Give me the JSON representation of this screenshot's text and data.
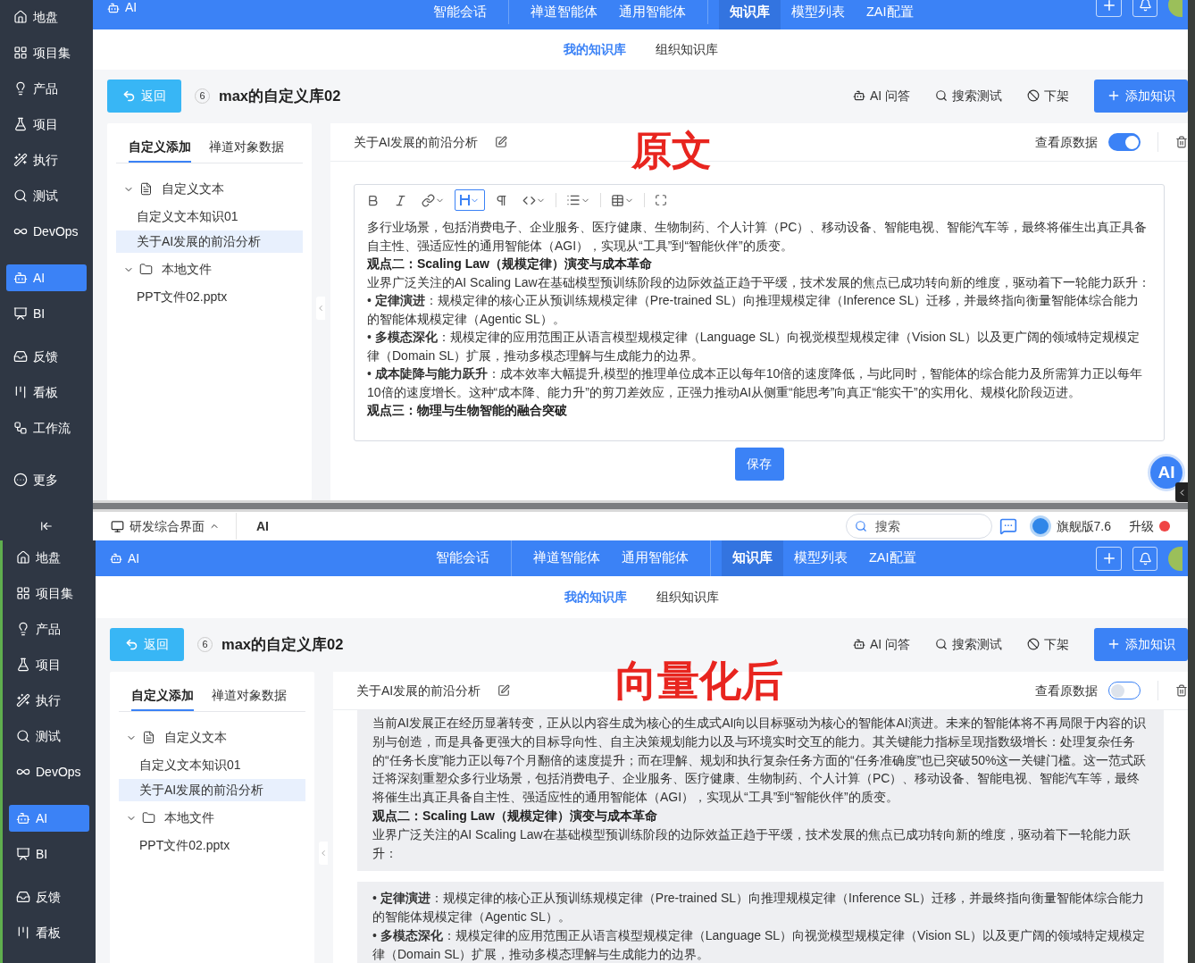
{
  "screens": [
    {
      "sidebar": {
        "items": [
          {
            "label": "地盘",
            "selected": false
          },
          {
            "label": "项目集",
            "selected": false
          },
          {
            "label": "产品",
            "selected": false
          },
          {
            "label": "项目",
            "selected": false
          },
          {
            "label": "执行",
            "selected": false
          },
          {
            "label": "测试",
            "selected": false
          },
          {
            "label": "DevOps",
            "selected": false
          },
          {
            "label": "AI",
            "selected": true
          },
          {
            "label": "BI",
            "selected": false
          },
          {
            "label": "反馈",
            "selected": false
          },
          {
            "label": "看板",
            "selected": false
          },
          {
            "label": "工作流",
            "selected": false
          },
          {
            "label": "更多",
            "selected": false
          }
        ]
      },
      "header": {
        "app": "AI",
        "nav": [
          [
            {
              "label": "智能会话",
              "selected": false
            }
          ],
          [
            {
              "label": "禅道智能体",
              "selected": false
            },
            {
              "label": "通用智能体",
              "selected": false
            }
          ],
          [
            {
              "label": "知识库",
              "selected": true
            },
            {
              "label": "模型列表",
              "selected": false
            },
            {
              "label": "ZAI配置",
              "selected": false
            }
          ]
        ]
      },
      "subnav": [
        {
          "label": "我的知识库",
          "selected": true
        },
        {
          "label": "组织知识库",
          "selected": false
        }
      ],
      "toolbar": {
        "back": "返回",
        "count": "6",
        "title": "max的自定义库02",
        "actions": [
          "AI 问答",
          "搜索测试",
          "下架"
        ],
        "add": "添加知识"
      },
      "left_panel": {
        "tabs": [
          {
            "label": "自定义添加",
            "selected": true
          },
          {
            "label": "禅道对象数据",
            "selected": false
          }
        ],
        "tree": [
          {
            "label": "自定义文本",
            "kind": "doc",
            "expanded": true,
            "children": [
              {
                "label": "自定义文本知识01",
                "selected": false
              },
              {
                "label": "关于AI发展的前沿分析",
                "selected": true
              }
            ]
          },
          {
            "label": "本地文件",
            "kind": "folder",
            "expanded": true,
            "children": [
              {
                "label": "PPT文件02.pptx",
                "selected": false
              }
            ]
          }
        ]
      },
      "doc": {
        "title": "关于AI发展的前沿分析",
        "annotation": "原文",
        "raw_toggle": {
          "label": "查看原数据",
          "on": true
        },
        "content": {
          "kind": "editor",
          "save": "保存",
          "blocks": [
            {
              "kind": "text",
              "text": "多行业场景，包括消费电子、企业服务、医疗健康、生物制药、个人计算（PC）、移动设备、智能电视、智能汽车等，最终将催生出真正具备自主性、强适应性的通用智能体（AGI），实现从“工具”到“智能伙伴”的质变。"
            },
            {
              "kind": "heading",
              "text": "观点二：Scaling Law（规模定律）演变与成本革命"
            },
            {
              "kind": "text",
              "text": "业界广泛关注的AI Scaling Law在基础模型预训练阶段的边际效益正趋于平缓，技术发展的焦点已成功转向新的维度，驱动着下一轮能力跃升："
            },
            {
              "kind": "text",
              "text": "• **定律演进**：规模定律的核心正从预训练规模定律（Pre-trained SL）向推理规模定律（Inference SL）迁移，并最终指向衡量智能体综合能力的智能体规模定律（Agentic SL）。"
            },
            {
              "kind": "text",
              "text": "• **多模态深化**：规模定律的应用范围正从语言模型规模定律（Language SL）向视觉模型规模定律（Vision SL）以及更广阔的领域特定规模定律（Domain SL）扩展，推动多模态理解与生成能力的边界。"
            },
            {
              "kind": "text",
              "text": "• **成本陡降与能力跃升**：成本效率大幅提升,模型的推理单位成本正以每年10倍的速度降低，与此同时，智能体的综合能力及所需算力正以每年10倍的速度增长。这种“成本降、能力升”的剪刀差效应，正强力推动AI从侧重“能思考”向真正“能实干”的实用化、规模化阶段迈进。"
            },
            {
              "kind": "heading",
              "text": "观点三：物理与生物智能的融合突破"
            }
          ]
        },
        "ai_button": "AI"
      }
    },
    {
      "sidebar": {
        "items": [
          {
            "label": "地盘",
            "selected": false
          },
          {
            "label": "项目集",
            "selected": false
          },
          {
            "label": "产品",
            "selected": false
          },
          {
            "label": "项目",
            "selected": false
          },
          {
            "label": "执行",
            "selected": false
          },
          {
            "label": "测试",
            "selected": false
          },
          {
            "label": "DevOps",
            "selected": false
          },
          {
            "label": "AI",
            "selected": true
          },
          {
            "label": "BI",
            "selected": false
          },
          {
            "label": "反馈",
            "selected": false
          },
          {
            "label": "看板",
            "selected": false
          }
        ]
      },
      "header": {
        "app": "AI",
        "nav": [
          [
            {
              "label": "智能会话",
              "selected": false
            }
          ],
          [
            {
              "label": "禅道智能体",
              "selected": false
            },
            {
              "label": "通用智能体",
              "selected": false
            }
          ],
          [
            {
              "label": "知识库",
              "selected": true
            },
            {
              "label": "模型列表",
              "selected": false
            },
            {
              "label": "ZAI配置",
              "selected": false
            }
          ]
        ]
      },
      "subnav": [
        {
          "label": "我的知识库",
          "selected": true
        },
        {
          "label": "组织知识库",
          "selected": false
        }
      ],
      "toolbar": {
        "back": "返回",
        "count": "6",
        "title": "max的自定义库02",
        "actions": [
          "AI 问答",
          "搜索测试",
          "下架"
        ],
        "add": "添加知识"
      },
      "left_panel": {
        "tabs": [
          {
            "label": "自定义添加",
            "selected": true
          },
          {
            "label": "禅道对象数据",
            "selected": false
          }
        ],
        "tree": [
          {
            "label": "自定义文本",
            "kind": "doc",
            "expanded": true,
            "children": [
              {
                "label": "自定义文本知识01",
                "selected": false
              },
              {
                "label": "关于AI发展的前沿分析",
                "selected": true
              }
            ]
          },
          {
            "label": "本地文件",
            "kind": "folder",
            "expanded": true,
            "children": [
              {
                "label": "PPT文件02.pptx",
                "selected": false
              }
            ]
          }
        ]
      },
      "doc": {
        "title": "关于AI发展的前沿分析",
        "annotation": "向量化后",
        "raw_toggle": {
          "label": "查看原数据",
          "on": false
        },
        "content": {
          "kind": "chunks",
          "chunks": [
            [
              {
                "kind": "text",
                "text": "当前AI发展正在经历显著转变，正从以内容生成为核心的生成式AI向以目标驱动为核心的智能体AI演进。未来的智能体将不再局限于内容的识别与创造，而是具备更强大的目标导向性、自主决策规划能力以及与环境实时交互的能力。其关键能力指标呈现指数级增长：处理复杂任务的“任务长度”能力正以每7个月翻倍的速度提升；而在理解、规划和执行复杂任务方面的“任务准确度”也已突破50%这一关键门槛。这一范式跃迁将深刻重塑众多行业场景，包括消费电子、企业服务、医疗健康、生物制药、个人计算（PC）、移动设备、智能电视、智能汽车等，最终将催生出真正具备自主性、强适应性的通用智能体（AGI），实现从“工具”到“智能伙伴”的质变。"
              },
              {
                "kind": "heading",
                "text": "观点二：Scaling Law（规模定律）演变与成本革命"
              },
              {
                "kind": "text",
                "text": "业界广泛关注的AI Scaling Law在基础模型预训练阶段的边际效益正趋于平缓，技术发展的焦点已成功转向新的维度，驱动着下一轮能力跃升："
              }
            ],
            [
              {
                "kind": "text",
                "text": "• **定律演进**：规模定律的核心正从预训练规模定律（Pre-trained SL）向推理规模定律（Inference SL）迁移，并最终指向衡量智能体综合能力的智能体规模定律（Agentic SL）。"
              },
              {
                "kind": "text",
                "text": "• **多模态深化**：规模定律的应用范围正从语言模型规模定律（Language SL）向视觉模型规模定律（Vision SL）以及更广阔的领域特定规模定律（Domain SL）扩展，推动多模态理解与生成能力的边界。"
              }
            ]
          ]
        }
      }
    }
  ],
  "breadcrumb_bar": {
    "workspace": "研发综合界面",
    "current": "AI",
    "search": {
      "placeholder": "搜索"
    },
    "edition": "旗舰版7.6",
    "upgrade": "升级"
  }
}
